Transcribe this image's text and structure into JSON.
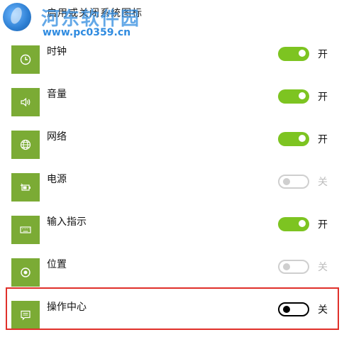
{
  "header": {
    "title": "启用或关闭系统图标",
    "watermark_name": "河东软件园",
    "watermark_url": "www.pc0359.cn"
  },
  "colors": {
    "tile": "#7bab35",
    "toggle_on": "#7dc421",
    "highlight": "#e0302a"
  },
  "items": [
    {
      "label": "时钟",
      "icon": "clock-icon",
      "state": "on",
      "state_label": "开"
    },
    {
      "label": "音量",
      "icon": "volume-icon",
      "state": "on",
      "state_label": "开"
    },
    {
      "label": "网络",
      "icon": "network-globe-icon",
      "state": "on",
      "state_label": "开"
    },
    {
      "label": "电源",
      "icon": "battery-power-icon",
      "state": "off-disabled",
      "state_label": "关"
    },
    {
      "label": "输入指示",
      "icon": "keyboard-icon",
      "state": "on",
      "state_label": "开"
    },
    {
      "label": "位置",
      "icon": "location-icon",
      "state": "off-disabled",
      "state_label": "关"
    },
    {
      "label": "操作中心",
      "icon": "action-center-icon",
      "state": "off",
      "state_label": "关"
    }
  ]
}
